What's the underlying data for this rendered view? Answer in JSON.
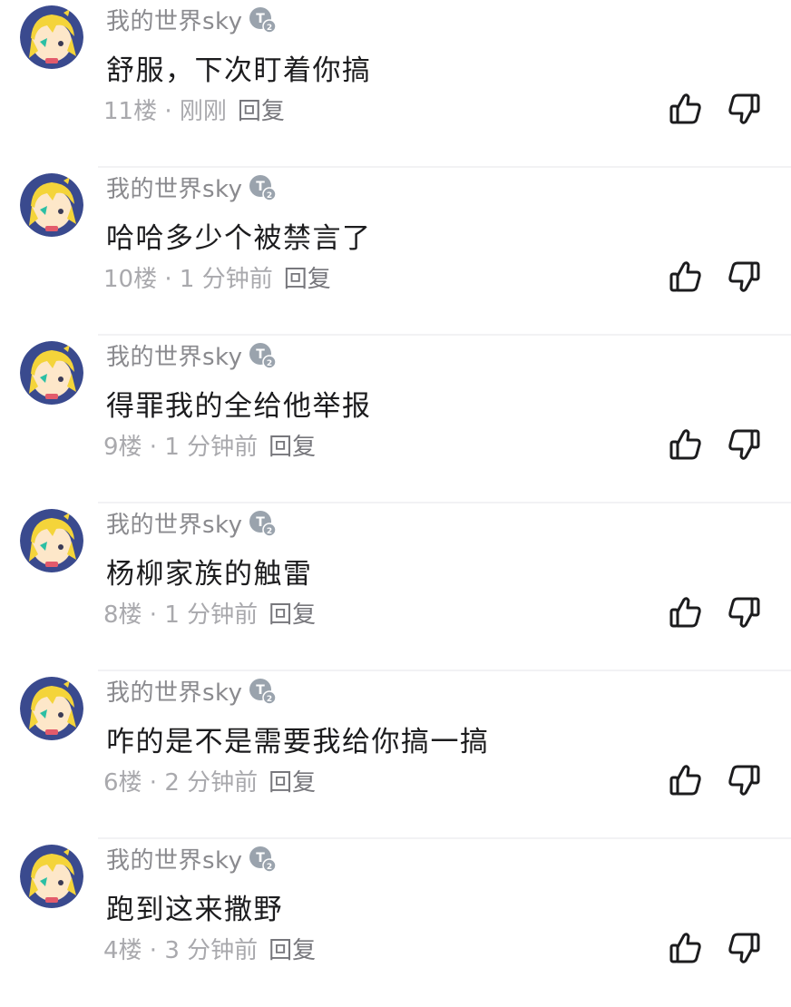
{
  "comments": [
    {
      "username": "我的世界sky",
      "text": "舒服，下次盯着你搞",
      "floor": "11楼",
      "time": "刚刚",
      "reply": "回复"
    },
    {
      "username": "我的世界sky",
      "text": "哈哈多少个被禁言了",
      "floor": "10楼",
      "time": "1 分钟前",
      "reply": "回复"
    },
    {
      "username": "我的世界sky",
      "text": "得罪我的全给他举报",
      "floor": "9楼",
      "time": "1 分钟前",
      "reply": "回复"
    },
    {
      "username": "我的世界sky",
      "text": "杨柳家族的触雷",
      "floor": "8楼",
      "time": "1 分钟前",
      "reply": "回复"
    },
    {
      "username": "我的世界sky",
      "text": "咋的是不是需要我给你搞一搞",
      "floor": "6楼",
      "time": "2 分钟前",
      "reply": "回复"
    },
    {
      "username": "我的世界sky",
      "text": "跑到这来撒野",
      "floor": "4楼",
      "time": "3 分钟前",
      "reply": "回复"
    }
  ],
  "separator": " · ",
  "icons": {
    "like": "thumbs-up-icon",
    "dislike": "thumbs-down-icon",
    "level_badge": "level-badge-icon"
  },
  "colors": {
    "username": "#8a8a8e",
    "text": "#1c1c1e",
    "meta": "#a9a9ad",
    "reply": "#77777c",
    "icon": "#1c1c1e",
    "avatar_bg": "#3a4a8e",
    "avatar_hair": "#f4d43a",
    "level_badge": "#9aa3ad"
  }
}
